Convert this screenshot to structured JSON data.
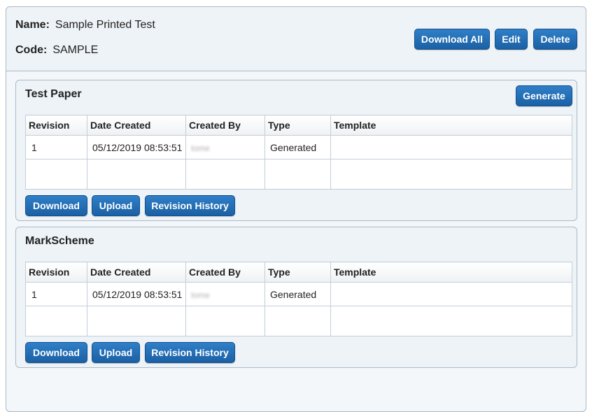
{
  "header": {
    "name_label": "Name:",
    "name_value": "Sample Printed Test",
    "code_label": "Code:",
    "code_value": "SAMPLE",
    "buttons": {
      "download_all": "Download All",
      "edit": "Edit",
      "delete": "Delete"
    }
  },
  "table_headers": [
    "Revision",
    "Date Created",
    "Created By",
    "Type",
    "Template"
  ],
  "sections": [
    {
      "title": "Test Paper",
      "generate_label": "Generate",
      "rows": [
        {
          "revision": "1",
          "date_created": "05/12/2019 08:53:51",
          "created_by": "tome",
          "type": "Generated",
          "template": ""
        }
      ],
      "buttons": {
        "download": "Download",
        "upload": "Upload",
        "revision_history": "Revision History"
      }
    },
    {
      "title": "MarkScheme",
      "rows": [
        {
          "revision": "1",
          "date_created": "05/12/2019 08:53:51",
          "created_by": "tome",
          "type": "Generated",
          "template": ""
        }
      ],
      "buttons": {
        "download": "Download",
        "upload": "Upload",
        "revision_history": "Revision History"
      }
    }
  ]
}
